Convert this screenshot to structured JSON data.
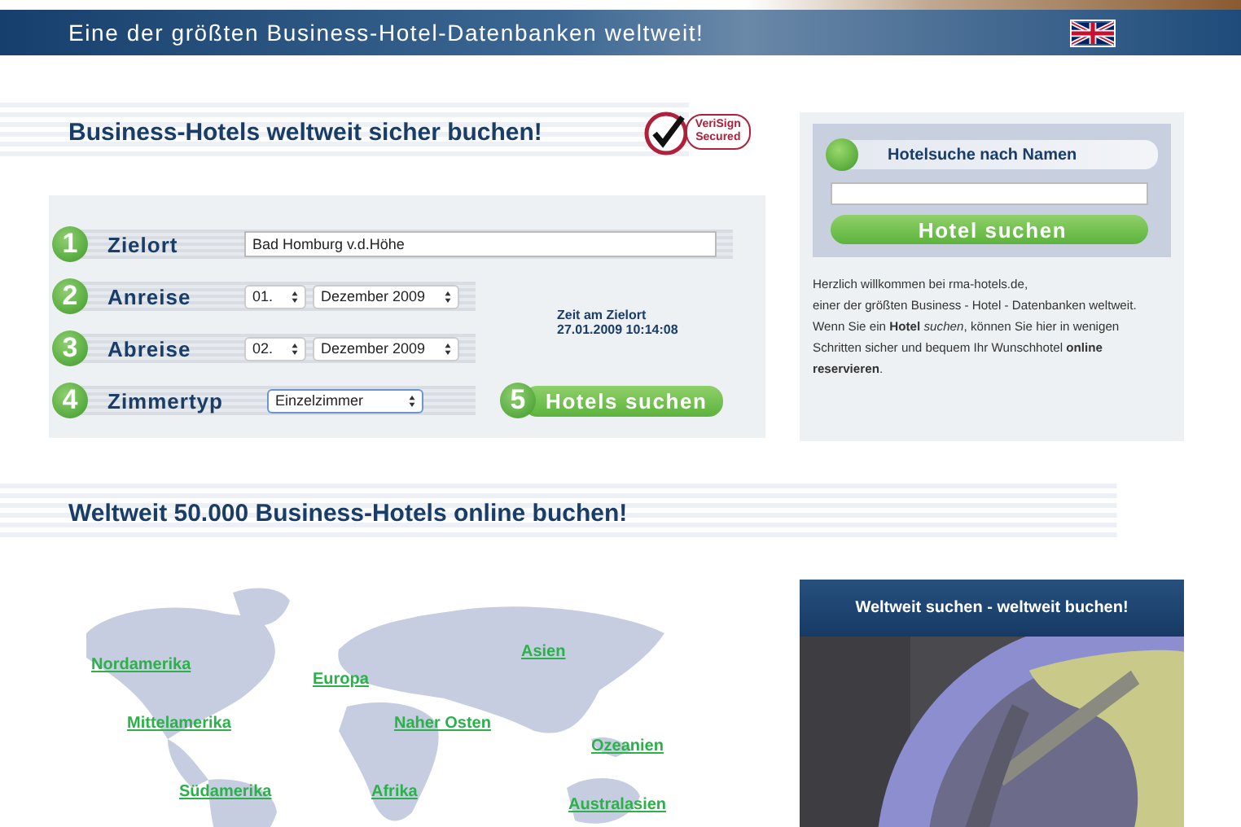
{
  "header": {
    "tagline": "Eine der größten Business-Hotel-Datenbanken weltweit!"
  },
  "booking": {
    "heading": "Business-Hotels weltweit sicher buchen!",
    "seal": [
      "VeriSign",
      "Secured"
    ],
    "rows": [
      {
        "kind": "text",
        "step": "1",
        "label": "Zielort",
        "value": "Bad Homburg v.d.Höhe"
      },
      {
        "kind": "date",
        "step": "2",
        "label": "Anreise",
        "day": "01.",
        "month": "Dezember 2009"
      },
      {
        "kind": "date",
        "step": "3",
        "label": "Abreise",
        "day": "02.",
        "month": "Dezember 2009"
      },
      {
        "kind": "select",
        "step": "4",
        "label": "Zimmertyp",
        "value": "Einzelzimmer"
      }
    ],
    "time_label": "Zeit am Zielort",
    "time_value": "27.01.2009 10:14:08",
    "submit": {
      "step": "5",
      "label": "Hotels suchen"
    }
  },
  "name_search": {
    "title": "Hotelsuche nach Namen",
    "button": "Hotel suchen",
    "welcome": [
      "Herzlich willkommen bei rma-hotels.de,",
      "einer der größten Business - Hotel - Datenbanken weltweit. Wenn Sie ein **Hotel** *suchen*, können Sie hier in wenigen Schritten sicher und bequem Ihr Wunschhotel **online reservieren**."
    ]
  },
  "world": {
    "heading": "Weltweit 50.000 Business-Hotels online buchen!",
    "regions": [
      {
        "label": "Nordamerika"
      },
      {
        "label": "Europa"
      },
      {
        "label": "Asien"
      },
      {
        "label": "Mittelamerika"
      },
      {
        "label": "Naher Osten"
      },
      {
        "label": "Ozeanien"
      },
      {
        "label": "Südamerika"
      },
      {
        "label": "Afrika"
      },
      {
        "label": "Australasien"
      }
    ]
  },
  "promo": {
    "title": "Weltweit suchen - weltweit buchen!"
  }
}
